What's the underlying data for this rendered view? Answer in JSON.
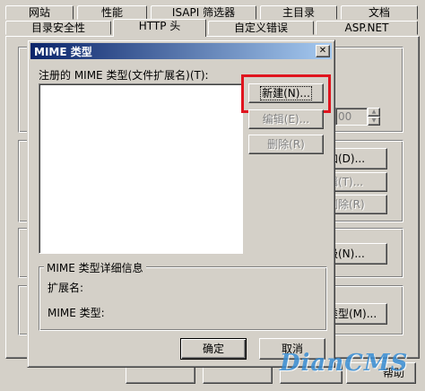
{
  "properties": {
    "tabs_row1": [
      "网站",
      "性能",
      "ISAPI 筛选器",
      "主目录",
      "文档"
    ],
    "tabs_row2": [
      "目录安全性",
      "HTTP 头",
      "自定义错误",
      "ASP.NET"
    ],
    "partial_add_label": "加(D)...",
    "partial_edit_label": "辑(T)...",
    "partial_delete_label": "删除(R)",
    "partial_spin_value": "00",
    "partial_levels_label": "级(N)...",
    "partial_mime_label": "类型(M)...",
    "help_label": "帮助"
  },
  "dialog": {
    "title": "MIME 类型",
    "close_glyph": "✕",
    "list_label": "注册的 MIME 类型(文件扩展名)(T):",
    "new_button": "新建(N)...",
    "edit_button": "编辑(E)...",
    "delete_button": "删除(R)",
    "details_group_label": "MIME 类型详细信息",
    "extension_label": "扩展名:",
    "mime_type_label": "MIME 类型:",
    "ok_button": "确定",
    "cancel_button": "取消"
  },
  "watermark": "DianCMS",
  "colors": {
    "face": "#d4d0c8",
    "titlebar_start": "#0a246a",
    "titlebar_end": "#a6caf0",
    "highlight_box": "#e0141e",
    "watermark_blue": "#3a8fd6"
  }
}
